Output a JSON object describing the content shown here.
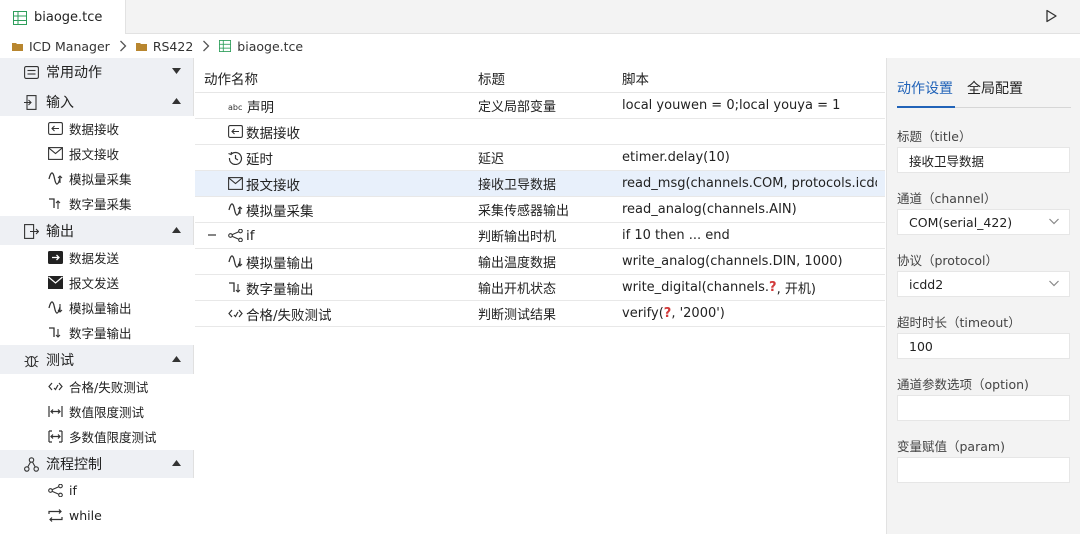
{
  "tab": {
    "title": "biaoge.tce"
  },
  "breadcrumb": [
    "ICD Manager",
    "RS422",
    "biaoge.tce"
  ],
  "sidebar": {
    "categories": [
      {
        "label": "常用动作",
        "items": []
      },
      {
        "label": "输入",
        "items": [
          "数据接收",
          "报文接收",
          "模拟量采集",
          "数字量采集"
        ]
      },
      {
        "label": "输出",
        "items": [
          "数据发送",
          "报文发送",
          "模拟量输出",
          "数字量输出"
        ]
      },
      {
        "label": "测试",
        "items": [
          "合格/失败测试",
          "数值限度测试",
          "多数值限度测试"
        ]
      },
      {
        "label": "流程控制",
        "items": [
          "if",
          "while"
        ]
      }
    ]
  },
  "table": {
    "headers": [
      "动作名称",
      "标题",
      "脚本"
    ],
    "rows": [
      {
        "icon": "abc",
        "name": "声明",
        "title": "定义局部变量",
        "script": "local youwen = 0;local youya = 1"
      },
      {
        "icon": "data-receive",
        "name": "数据接收",
        "title": "",
        "script": ""
      },
      {
        "icon": "timer",
        "name": "延时",
        "title": "延迟",
        "script": "etimer.delay(10)"
      },
      {
        "icon": "mail",
        "name": "报文接收",
        "title": "接收卫导数据",
        "script": "read_msg(channels.COM, protocols.icdd…"
      },
      {
        "icon": "wave",
        "name": "模拟量采集",
        "title": "采集传感器输出",
        "script": "read_analog(channels.AIN)"
      },
      {
        "icon": "branch",
        "name": "if",
        "title": "判断输出时机",
        "script": "if 10 then ... end"
      },
      {
        "icon": "wave-out",
        "name": "模拟量输出",
        "title": "输出温度数据",
        "script": "write_analog(channels.DIN, 1000)"
      },
      {
        "icon": "digital-out",
        "name": "数字量输出",
        "title": "输出开机状态",
        "script_a": "write_digital(channels.",
        "script_q": "?",
        "script_b": ", 开机)"
      },
      {
        "icon": "code",
        "name": "合格/失败测试",
        "title": "判断测试结果",
        "script_a": "verify(",
        "script_q": "?",
        "script_b": ", '2000')"
      }
    ]
  },
  "panel": {
    "tabs": [
      "动作设置",
      "全局配置"
    ],
    "fields": [
      {
        "label": "标题（title）",
        "value": "接收卫导数据"
      },
      {
        "label": "通道（channel）",
        "value": "COM(serial_422)"
      },
      {
        "label": "协议（protocol）",
        "value": "icdd2"
      },
      {
        "label": "超时时长（timeout）",
        "value": "100"
      },
      {
        "label": "通道参数选项（option)",
        "value": ""
      },
      {
        "label": "变量赋值（param)",
        "value": ""
      }
    ]
  },
  "colors": {
    "accent": "#2163b8",
    "selected_row": "#e8f0fb",
    "sidebar_bg": "#eef0f4",
    "panel_bg": "#f3f3f3",
    "question": "#d23a3a"
  }
}
